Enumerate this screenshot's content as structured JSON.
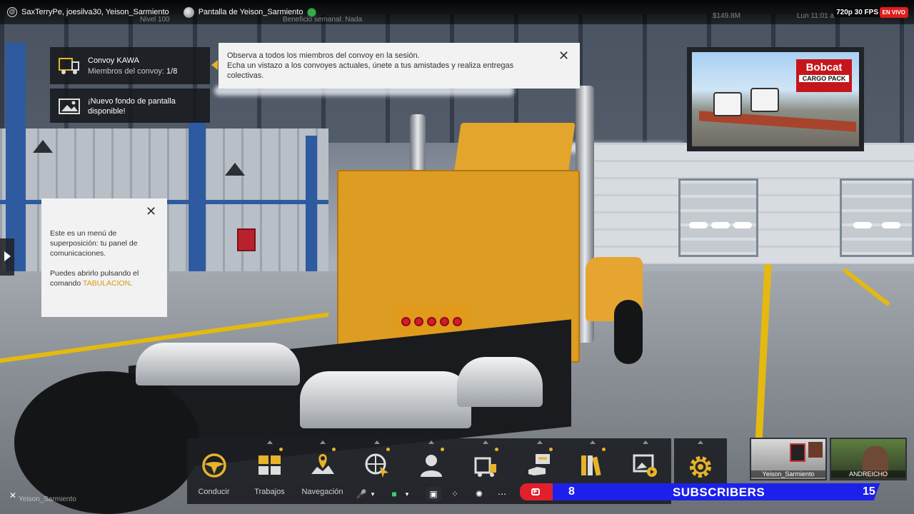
{
  "stream": {
    "participants": "SaxTerryPe, joesilva30, Yeison_Sarmiento",
    "screen_share_title": "Pantalla de Yeison_Sarmiento",
    "resolution": "720p 30 FPS",
    "live_badge": "EN VIVO",
    "presenter_name": "Yeison_Sarmiento"
  },
  "game_hud_background": {
    "level": "Nivel 100",
    "weekly_benefit": "Beneficio semanal: Nada",
    "money": "$149.8M",
    "datetime": "Lun 11:01 a"
  },
  "notifications": [
    {
      "title": "Convoy KAWA",
      "subtitle_prefix": "Miembros del convoy: ",
      "subtitle_value": "1/8"
    },
    {
      "title": "¡Nuevo fondo de pantalla",
      "subtitle": "disponible!"
    }
  ],
  "convoy_hint": {
    "line1": "Observa a todos los miembros del convoy en la sesión.",
    "line2": "Echa un vistazo a los convoyes actuales, únete a tus amistades y realiza entregas",
    "line3": "colectivas."
  },
  "tab_hint": {
    "p1_line1": "Este es un menú de",
    "p1_line2": "superposición: tu panel de",
    "p1_line3": "comunicaciones.",
    "p2_line1": "Puedes abrirlo pulsando el",
    "p2_line2_prefix": "comando ",
    "p2_keyword": "TABULACION",
    "p2_suffix": "."
  },
  "ad": {
    "brand": "Bobcat",
    "product": "CARGO PACK"
  },
  "menu": [
    {
      "label": "Conducir",
      "icon": "steering-wheel-icon"
    },
    {
      "label": "Trabajos",
      "icon": "cargo-boxes-icon"
    },
    {
      "label": "Navegación",
      "icon": "map-pin-icon"
    },
    {
      "label": "",
      "icon": "online-globe-icon"
    },
    {
      "label": "",
      "icon": "profile-icon"
    },
    {
      "label": "",
      "icon": "truck-garage-icon"
    },
    {
      "label": "",
      "icon": "trading-icon"
    },
    {
      "label": "",
      "icon": "books-icon"
    },
    {
      "label": "",
      "icon": "gallery-icon"
    }
  ],
  "settings_icon": "gear-icon",
  "subscribers": {
    "current": "8",
    "label": "SUBSCRIBERS",
    "goal": "15"
  },
  "webcams": [
    {
      "name": "Yeison_Sarmiento"
    },
    {
      "name": "ANDREICHO"
    }
  ],
  "colors": {
    "accent_yellow": "#e6b32a",
    "live_red": "#e01d1d",
    "subs_blue": "#1c20ea",
    "subs_red": "#e0212b",
    "truck_orange": "#dd9c22"
  }
}
